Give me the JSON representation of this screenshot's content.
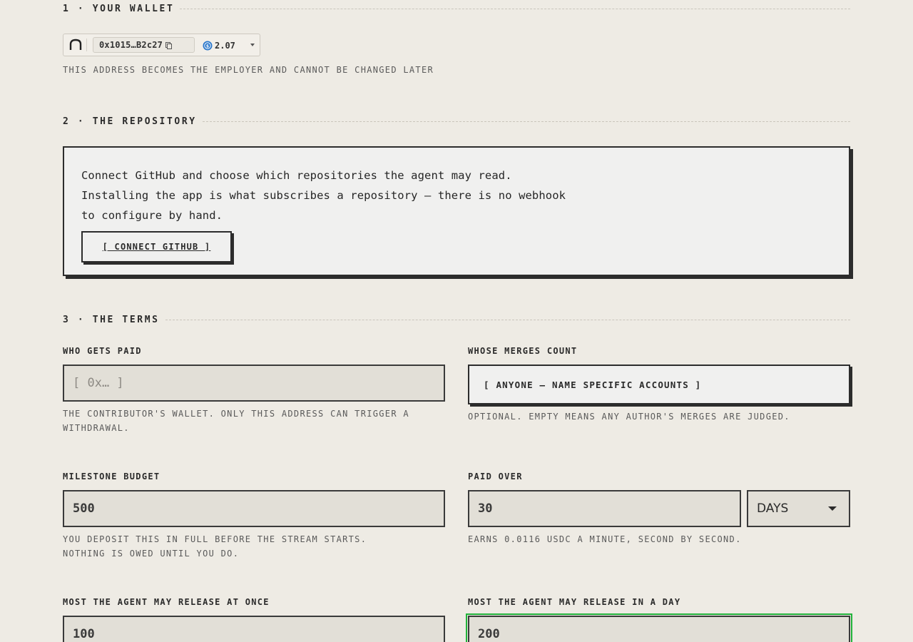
{
  "sections": {
    "wallet": {
      "title": "1 · YOUR WALLET"
    },
    "repo": {
      "title": "2 · THE REPOSITORY"
    },
    "terms": {
      "title": "3 · THE TERMS"
    }
  },
  "wallet": {
    "address": "0x1015…B2c27",
    "balance": "2.07",
    "hint": "THIS ADDRESS BECOMES THE EMPLOYER AND CANNOT BE CHANGED LATER"
  },
  "repo": {
    "line1": "Connect GitHub and choose which repositories the agent may read.",
    "line2": "Installing the app is what subscribes a repository — there is no webhook",
    "line3": "to configure by hand.",
    "connect_label": "[ CONNECT GITHUB ]"
  },
  "terms": {
    "who_gets_paid": {
      "label": "WHO GETS PAID",
      "placeholder": "[ 0x… ]",
      "hint1": "THE CONTRIBUTOR'S WALLET. ONLY THIS ADDRESS CAN TRIGGER A",
      "hint2": "WITHDRAWAL."
    },
    "whose_merges": {
      "label": "WHOSE MERGES COUNT",
      "button": "[ ANYONE — NAME SPECIFIC ACCOUNTS ]",
      "hint": "OPTIONAL. EMPTY MEANS ANY AUTHOR'S MERGES ARE JUDGED."
    },
    "budget": {
      "label": "MILESTONE BUDGET",
      "value": "500",
      "hint1": "YOU DEPOSIT THIS IN FULL BEFORE THE STREAM STARTS.",
      "hint2": "NOTHING IS OWED UNTIL YOU DO."
    },
    "paid_over": {
      "label": "PAID OVER",
      "value": "30",
      "unit": "DAYS",
      "hint": "EARNS 0.0116 USDC A MINUTE, SECOND BY SECOND."
    },
    "max_once": {
      "label": "MOST THE AGENT MAY RELEASE AT ONCE",
      "value": "100"
    },
    "max_day": {
      "label": "MOST THE AGENT MAY RELEASE IN A DAY",
      "value": "200"
    }
  },
  "colors": {
    "background": "#eeebe4",
    "ink": "#2c2c2c",
    "focus": "#21b23a",
    "usdc": "#2775ca"
  },
  "icons": [
    "app-logo-icon",
    "copy-icon",
    "usdc-icon",
    "chevron-down-icon"
  ]
}
